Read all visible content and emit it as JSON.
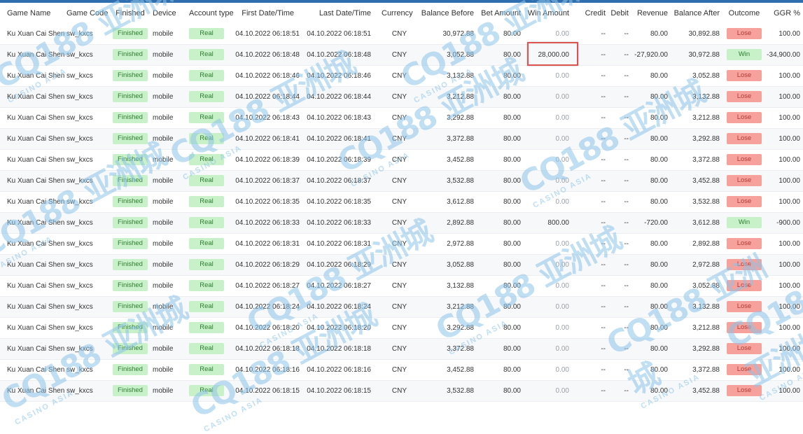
{
  "columns": [
    "Game Name",
    "Game Code",
    "Finished",
    "Device",
    "Account type",
    "First Date/Time",
    "Last Date/Time",
    "Currency",
    "Balance Before",
    "Bet Amount",
    "Win Amount",
    "Credit",
    "Debit",
    "Revenue",
    "Balance After",
    "Outcome",
    "GGR %"
  ],
  "rows": [
    {
      "game": "Ku Xuan Cai Shen",
      "code": "sw_kxcs",
      "status": "Finished",
      "device": "mobile",
      "account": "Real",
      "first": "04.10.2022 06:18:51",
      "last": "04.10.2022 06:18:51",
      "currency": "CNY",
      "before": "30,972.88",
      "bet": "80.00",
      "win": "0.00",
      "credit": "--",
      "debit": "--",
      "revenue": "80.00",
      "after": "30,892.88",
      "outcome": "Lose",
      "ggr": "100.00"
    },
    {
      "game": "Ku Xuan Cai Shen",
      "code": "sw_kxcs",
      "status": "Finished",
      "device": "mobile",
      "account": "Real",
      "first": "04.10.2022 06:18:48",
      "last": "04.10.2022 06:18:48",
      "currency": "CNY",
      "before": "3,052.88",
      "bet": "80.00",
      "win": "28,000.00",
      "credit": "--",
      "debit": "--",
      "revenue": "-27,920.00",
      "after": "30,972.88",
      "outcome": "Win",
      "ggr": "-34,900.00"
    },
    {
      "game": "Ku Xuan Cai Shen",
      "code": "sw_kxcs",
      "status": "Finished",
      "device": "mobile",
      "account": "Real",
      "first": "04.10.2022 06:18:46",
      "last": "04.10.2022 06:18:46",
      "currency": "CNY",
      "before": "3,132.88",
      "bet": "80.00",
      "win": "0.00",
      "credit": "--",
      "debit": "--",
      "revenue": "80.00",
      "after": "3,052.88",
      "outcome": "Lose",
      "ggr": "100.00"
    },
    {
      "game": "Ku Xuan Cai Shen",
      "code": "sw_kxcs",
      "status": "Finished",
      "device": "mobile",
      "account": "Real",
      "first": "04.10.2022 06:18:44",
      "last": "04.10.2022 06:18:44",
      "currency": "CNY",
      "before": "3,212.88",
      "bet": "80.00",
      "win": "0.00",
      "credit": "--",
      "debit": "--",
      "revenue": "80.00",
      "after": "3,132.88",
      "outcome": "Lose",
      "ggr": "100.00"
    },
    {
      "game": "Ku Xuan Cai Shen",
      "code": "sw_kxcs",
      "status": "Finished",
      "device": "mobile",
      "account": "Real",
      "first": "04.10.2022 06:18:43",
      "last": "04.10.2022 06:18:43",
      "currency": "CNY",
      "before": "3,292.88",
      "bet": "80.00",
      "win": "0.00",
      "credit": "--",
      "debit": "--",
      "revenue": "80.00",
      "after": "3,212.88",
      "outcome": "Lose",
      "ggr": "100.00"
    },
    {
      "game": "Ku Xuan Cai Shen",
      "code": "sw_kxcs",
      "status": "Finished",
      "device": "mobile",
      "account": "Real",
      "first": "04.10.2022 06:18:41",
      "last": "04.10.2022 06:18:41",
      "currency": "CNY",
      "before": "3,372.88",
      "bet": "80.00",
      "win": "0.00",
      "credit": "--",
      "debit": "--",
      "revenue": "80.00",
      "after": "3,292.88",
      "outcome": "Lose",
      "ggr": "100.00"
    },
    {
      "game": "Ku Xuan Cai Shen",
      "code": "sw_kxcs",
      "status": "Finished",
      "device": "mobile",
      "account": "Real",
      "first": "04.10.2022 06:18:39",
      "last": "04.10.2022 06:18:39",
      "currency": "CNY",
      "before": "3,452.88",
      "bet": "80.00",
      "win": "0.00",
      "credit": "--",
      "debit": "--",
      "revenue": "80.00",
      "after": "3,372.88",
      "outcome": "Lose",
      "ggr": "100.00"
    },
    {
      "game": "Ku Xuan Cai Shen",
      "code": "sw_kxcs",
      "status": "Finished",
      "device": "mobile",
      "account": "Real",
      "first": "04.10.2022 06:18:37",
      "last": "04.10.2022 06:18:37",
      "currency": "CNY",
      "before": "3,532.88",
      "bet": "80.00",
      "win": "0.00",
      "credit": "--",
      "debit": "--",
      "revenue": "80.00",
      "after": "3,452.88",
      "outcome": "Lose",
      "ggr": "100.00"
    },
    {
      "game": "Ku Xuan Cai Shen",
      "code": "sw_kxcs",
      "status": "Finished",
      "device": "mobile",
      "account": "Real",
      "first": "04.10.2022 06:18:35",
      "last": "04.10.2022 06:18:35",
      "currency": "CNY",
      "before": "3,612.88",
      "bet": "80.00",
      "win": "0.00",
      "credit": "--",
      "debit": "--",
      "revenue": "80.00",
      "after": "3,532.88",
      "outcome": "Lose",
      "ggr": "100.00"
    },
    {
      "game": "Ku Xuan Cai Shen",
      "code": "sw_kxcs",
      "status": "Finished",
      "device": "mobile",
      "account": "Real",
      "first": "04.10.2022 06:18:33",
      "last": "04.10.2022 06:18:33",
      "currency": "CNY",
      "before": "2,892.88",
      "bet": "80.00",
      "win": "800.00",
      "credit": "--",
      "debit": "--",
      "revenue": "-720.00",
      "after": "3,612.88",
      "outcome": "Win",
      "ggr": "-900.00"
    },
    {
      "game": "Ku Xuan Cai Shen",
      "code": "sw_kxcs",
      "status": "Finished",
      "device": "mobile",
      "account": "Real",
      "first": "04.10.2022 06:18:31",
      "last": "04.10.2022 06:18:31",
      "currency": "CNY",
      "before": "2,972.88",
      "bet": "80.00",
      "win": "0.00",
      "credit": "--",
      "debit": "--",
      "revenue": "80.00",
      "after": "2,892.88",
      "outcome": "Lose",
      "ggr": "100.00"
    },
    {
      "game": "Ku Xuan Cai Shen",
      "code": "sw_kxcs",
      "status": "Finished",
      "device": "mobile",
      "account": "Real",
      "first": "04.10.2022 06:18:29",
      "last": "04.10.2022 06:18:29",
      "currency": "CNY",
      "before": "3,052.88",
      "bet": "80.00",
      "win": "0.00",
      "credit": "--",
      "debit": "--",
      "revenue": "80.00",
      "after": "2,972.88",
      "outcome": "Lose",
      "ggr": "100.00"
    },
    {
      "game": "Ku Xuan Cai Shen",
      "code": "sw_kxcs",
      "status": "Finished",
      "device": "mobile",
      "account": "Real",
      "first": "04.10.2022 06:18:27",
      "last": "04.10.2022 06:18:27",
      "currency": "CNY",
      "before": "3,132.88",
      "bet": "80.00",
      "win": "0.00",
      "credit": "--",
      "debit": "--",
      "revenue": "80.00",
      "after": "3,052.88",
      "outcome": "Lose",
      "ggr": "100.00"
    },
    {
      "game": "Ku Xuan Cai Shen",
      "code": "sw_kxcs",
      "status": "Finished",
      "device": "mobile",
      "account": "Real",
      "first": "04.10.2022 06:18:24",
      "last": "04.10.2022 06:18:24",
      "currency": "CNY",
      "before": "3,212.88",
      "bet": "80.00",
      "win": "0.00",
      "credit": "--",
      "debit": "--",
      "revenue": "80.00",
      "after": "3,132.88",
      "outcome": "Lose",
      "ggr": "100.00"
    },
    {
      "game": "Ku Xuan Cai Shen",
      "code": "sw_kxcs",
      "status": "Finished",
      "device": "mobile",
      "account": "Real",
      "first": "04.10.2022 06:18:20",
      "last": "04.10.2022 06:18:20",
      "currency": "CNY",
      "before": "3,292.88",
      "bet": "80.00",
      "win": "0.00",
      "credit": "--",
      "debit": "--",
      "revenue": "80.00",
      "after": "3,212.88",
      "outcome": "Lose",
      "ggr": "100.00"
    },
    {
      "game": "Ku Xuan Cai Shen",
      "code": "sw_kxcs",
      "status": "Finished",
      "device": "mobile",
      "account": "Real",
      "first": "04.10.2022 06:18:18",
      "last": "04.10.2022 06:18:18",
      "currency": "CNY",
      "before": "3,372.88",
      "bet": "80.00",
      "win": "0.00",
      "credit": "--",
      "debit": "--",
      "revenue": "80.00",
      "after": "3,292.88",
      "outcome": "Lose",
      "ggr": "100.00"
    },
    {
      "game": "Ku Xuan Cai Shen",
      "code": "sw_kxcs",
      "status": "Finished",
      "device": "mobile",
      "account": "Real",
      "first": "04.10.2022 06:18:16",
      "last": "04.10.2022 06:18:16",
      "currency": "CNY",
      "before": "3,452.88",
      "bet": "80.00",
      "win": "0.00",
      "credit": "--",
      "debit": "--",
      "revenue": "80.00",
      "after": "3,372.88",
      "outcome": "Lose",
      "ggr": "100.00"
    },
    {
      "game": "Ku Xuan Cai Shen",
      "code": "sw_kxcs",
      "status": "Finished",
      "device": "mobile",
      "account": "Real",
      "first": "04.10.2022 06:18:15",
      "last": "04.10.2022 06:18:15",
      "currency": "CNY",
      "before": "3,532.88",
      "bet": "80.00",
      "win": "0.00",
      "credit": "--",
      "debit": "--",
      "revenue": "80.00",
      "after": "3,452.88",
      "outcome": "Lose",
      "ggr": "100.00"
    }
  ],
  "watermark": {
    "logo": "CQ188 亚洲城",
    "sub": "CASINO ASIA"
  },
  "colors": {
    "lose_bg": "#f6a19c",
    "win_bg": "#c9f1c9",
    "finished_bg": "#c9f1c9",
    "highlight": "#d9534f",
    "header_bar": "#2f6fb0"
  }
}
